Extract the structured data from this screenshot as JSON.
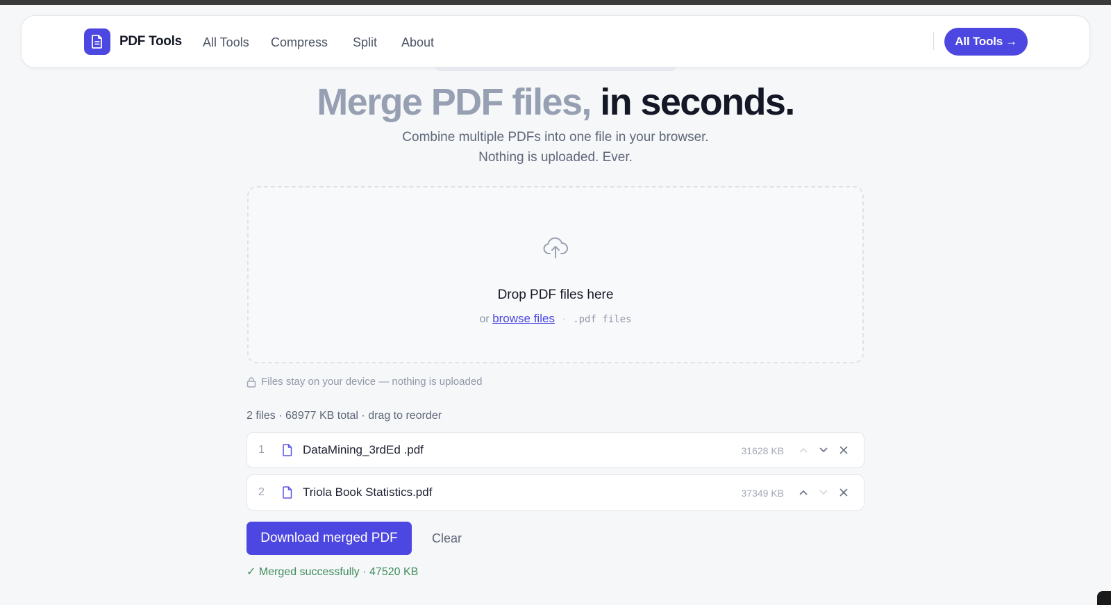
{
  "nav": {
    "brand": "PDF Tools",
    "links": [
      "All Tools",
      "Compress",
      "Split",
      "About"
    ],
    "cta_label": "All Tools",
    "cta_arrow": "→"
  },
  "hero": {
    "title_light": "Merge PDF files,",
    "title_dark": "in seconds.",
    "subtitle_line1": "Combine multiple PDFs into one file in your browser.",
    "subtitle_line2": "Nothing is uploaded. Ever."
  },
  "dropzone": {
    "title": "Drop PDF files here",
    "or_text": "or",
    "browse_label": "browse files",
    "separator": "·",
    "accepted": ".pdf files"
  },
  "privacy_note": "Files stay on your device — nothing is uploaded",
  "summary": "2 files · 68977 KB total · drag to reorder",
  "files": [
    {
      "index": "1",
      "name": "DataMining_3rdEd .pdf",
      "size": "31628 KB"
    },
    {
      "index": "2",
      "name": "Triola Book Statistics.pdf",
      "size": "37349 KB"
    }
  ],
  "actions": {
    "download_label": "Download merged PDF",
    "clear_label": "Clear"
  },
  "status": "✓ Merged successfully · 47520 KB",
  "colors": {
    "accent": "#4c47e0",
    "success": "#3f8d5b",
    "muted": "#97a0b3"
  }
}
